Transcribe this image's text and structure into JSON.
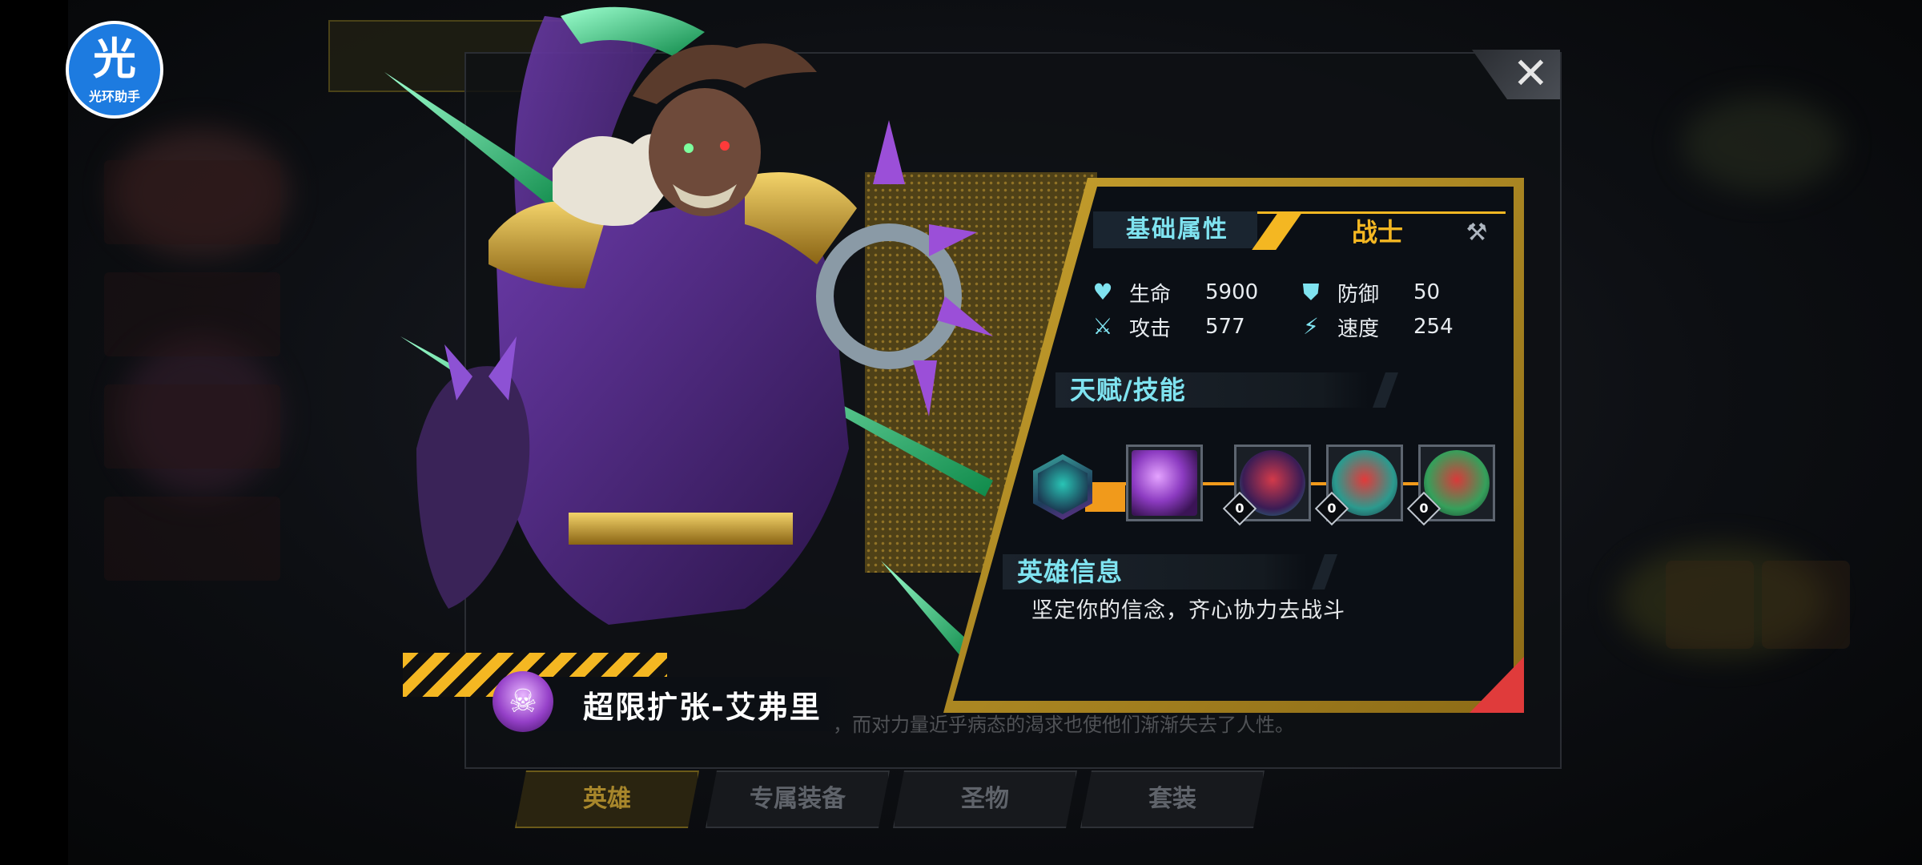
{
  "app_logo": {
    "glyph": "光",
    "label": "光环助手"
  },
  "close_button": {
    "label": "✕"
  },
  "hero": {
    "name": "超限扩张-艾弗里",
    "class": "战士",
    "description": "坚定你的信念，齐心协力去战斗",
    "lore_partial": "，而对力量近乎病态的渴求也使他们渐渐失去了人性。"
  },
  "sections": {
    "attributes": "基础属性",
    "skills": "天赋/技能",
    "hero_info": "英雄信息"
  },
  "stats": [
    {
      "icon": "heart-icon",
      "name": "生命",
      "value": "5900"
    },
    {
      "icon": "shield-icon",
      "name": "防御",
      "value": "50"
    },
    {
      "icon": "sword-icon",
      "name": "攻击",
      "value": "577"
    },
    {
      "icon": "lightning-icon",
      "name": "速度",
      "value": "254"
    }
  ],
  "skills": [
    {
      "name": "talent-hex",
      "level": ""
    },
    {
      "name": "skill-1",
      "level": ""
    },
    {
      "name": "skill-2",
      "level": "0"
    },
    {
      "name": "skill-3",
      "level": "0"
    },
    {
      "name": "skill-4",
      "level": "0"
    }
  ],
  "tabs": [
    {
      "label": "英雄",
      "active": true
    },
    {
      "label": "专属装备",
      "active": false
    },
    {
      "label": "圣物",
      "active": false
    },
    {
      "label": "套装",
      "active": false
    }
  ],
  "colors": {
    "accent_cyan": "#7fe3f0",
    "accent_gold": "#f4b722",
    "skill_orange": "#f19a1b",
    "panel_border_gold": "#c8a12e",
    "corner_red": "#e03b3b"
  }
}
